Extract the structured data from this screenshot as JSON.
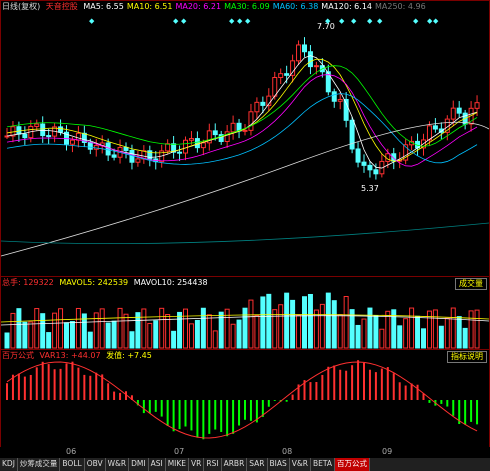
{
  "price_panel": {
    "mode_label": "日线(复权)",
    "stock_name": "天音控股",
    "ma": [
      {
        "label": "MA5: 6.55",
        "color": "#ffffff"
      },
      {
        "label": "MA10: 6.51",
        "color": "#ffff00"
      },
      {
        "label": "MA20: 6.21",
        "color": "#ff00ff"
      },
      {
        "label": "MA30: 6.09",
        "color": "#00ff00"
      },
      {
        "label": "MA60: 6.38",
        "color": "#00c0ff"
      },
      {
        "label": "MA120: 6.14",
        "color": "#ffffff"
      },
      {
        "label": "MA250: 4.96",
        "color": "#777777"
      }
    ],
    "high_label": "7.70",
    "low_label": "5.37"
  },
  "volume_panel": {
    "vol_label": "总手: 129322",
    "mavol5_label": "MAVOL5: 242539",
    "mavol10_label": "MAVOL10: 254438",
    "button_label": "成交量"
  },
  "indicator_panel": {
    "name": "百万公式",
    "var13_label": "VAR13: +44.07",
    "var_b_label": "发值: +7.45",
    "button_label": "指标说明"
  },
  "x_axis": [
    "06",
    "07",
    "08",
    "09"
  ],
  "tabs": [
    "KDJ",
    "炒筹成交量",
    "BOLL",
    "OBV",
    "W&R",
    "DMI",
    "ASI",
    "MIKE",
    "VR",
    "RSI",
    "ARBR",
    "SAR",
    "BIAS",
    "V&R",
    "BETA",
    "百万公式"
  ],
  "active_tab": "百万公式",
  "colors": {
    "up": "#ff3030",
    "down": "#54ffff",
    "border": "#7a0000",
    "tab_active": "#c00000"
  }
}
